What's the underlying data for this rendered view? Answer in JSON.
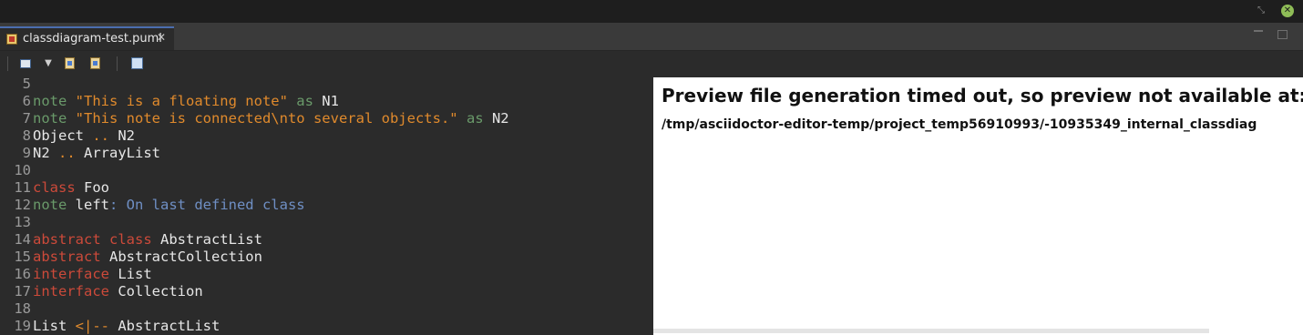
{
  "tab": {
    "title": "classdiagram-test.puml"
  },
  "icons": {
    "tab": "puml-file-icon",
    "tab_close": "close-icon",
    "window_restore": "restore-icon",
    "window_close": "close-icon",
    "grid": "grid-icon",
    "dropdown": "chevron-down-icon",
    "import": "import-icon",
    "export": "export-icon",
    "refresh": "refresh-icon",
    "minimize": "minimize-icon",
    "maximize": "maximize-icon"
  },
  "colors": {
    "keyword_red": "#cc4a3a",
    "string_orange": "#e08a2c",
    "note_green": "#6a9a6a",
    "text_blue": "#6f8fc4",
    "editor_bg": "#2b2b2b",
    "active_tab_border": "#4b6eaf"
  },
  "editor": {
    "lines": [
      {
        "num": "5",
        "tokens": []
      },
      {
        "num": "6",
        "tokens": [
          {
            "text": "note ",
            "cls": "t-green"
          },
          {
            "text": "\"This is a floating note\"",
            "cls": "t-orange"
          },
          {
            "text": " as ",
            "cls": "t-green"
          },
          {
            "text": "N1",
            "cls": "t-white"
          }
        ]
      },
      {
        "num": "7",
        "tokens": [
          {
            "text": "note ",
            "cls": "t-green"
          },
          {
            "text": "\"This note is connected\\nto several objects.\"",
            "cls": "t-orange"
          },
          {
            "text": " as ",
            "cls": "t-green"
          },
          {
            "text": "N2",
            "cls": "t-white"
          }
        ]
      },
      {
        "num": "8",
        "tokens": [
          {
            "text": "Object ",
            "cls": "t-white"
          },
          {
            "text": "..",
            "cls": "t-orange"
          },
          {
            "text": " N2",
            "cls": "t-white"
          }
        ]
      },
      {
        "num": "9",
        "tokens": [
          {
            "text": "N2 ",
            "cls": "t-white"
          },
          {
            "text": "..",
            "cls": "t-orange"
          },
          {
            "text": " ArrayList",
            "cls": "t-white"
          }
        ]
      },
      {
        "num": "10",
        "tokens": []
      },
      {
        "num": "11",
        "tokens": [
          {
            "text": "class",
            "cls": "t-red"
          },
          {
            "text": " Foo",
            "cls": "t-white"
          }
        ]
      },
      {
        "num": "12",
        "tokens": [
          {
            "text": "note",
            "cls": "t-green"
          },
          {
            "text": " left",
            "cls": "t-white"
          },
          {
            "text": ": On last defined class",
            "cls": "t-blue"
          }
        ]
      },
      {
        "num": "13",
        "tokens": []
      },
      {
        "num": "14",
        "tokens": [
          {
            "text": "abstract class",
            "cls": "t-red"
          },
          {
            "text": " AbstractList",
            "cls": "t-white"
          }
        ]
      },
      {
        "num": "15",
        "tokens": [
          {
            "text": "abstract",
            "cls": "t-red"
          },
          {
            "text": " AbstractCollection",
            "cls": "t-white"
          }
        ]
      },
      {
        "num": "16",
        "tokens": [
          {
            "text": "interface",
            "cls": "t-red"
          },
          {
            "text": " List",
            "cls": "t-white"
          }
        ]
      },
      {
        "num": "17",
        "tokens": [
          {
            "text": "interface",
            "cls": "t-red"
          },
          {
            "text": " Collection",
            "cls": "t-white"
          }
        ]
      },
      {
        "num": "18",
        "tokens": []
      },
      {
        "num": "19",
        "tokens": [
          {
            "text": "List ",
            "cls": "t-white"
          },
          {
            "text": "<|--",
            "cls": "t-orange"
          },
          {
            "text": " AbstractList",
            "cls": "t-white"
          }
        ]
      }
    ]
  },
  "preview": {
    "heading": "Preview file generation timed out, so preview not available at:",
    "path": "/tmp/asciidoctor-editor-temp/project_temp56910993/-10935349_internal_classdiag"
  }
}
